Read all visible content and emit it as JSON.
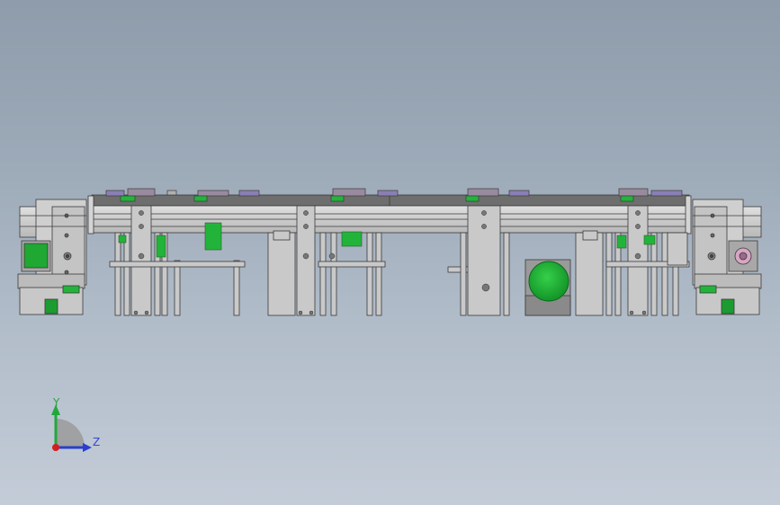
{
  "viewport": {
    "background_top": "#8e9cab",
    "background_bottom": "#c3ccd7"
  },
  "colors": {
    "frame_fill": "#c9c9c9",
    "frame_stroke": "#3a3a3a",
    "belt_top": "#6a6a6a",
    "motor_green": "#22b43a",
    "bolt": "#555555",
    "pink_cap": "#d8a6c4"
  },
  "triad": {
    "y_label": "Y",
    "z_label": "Z",
    "y_color": "#22a83a",
    "z_color": "#2a3fd0",
    "origin_color": "#d02020"
  }
}
